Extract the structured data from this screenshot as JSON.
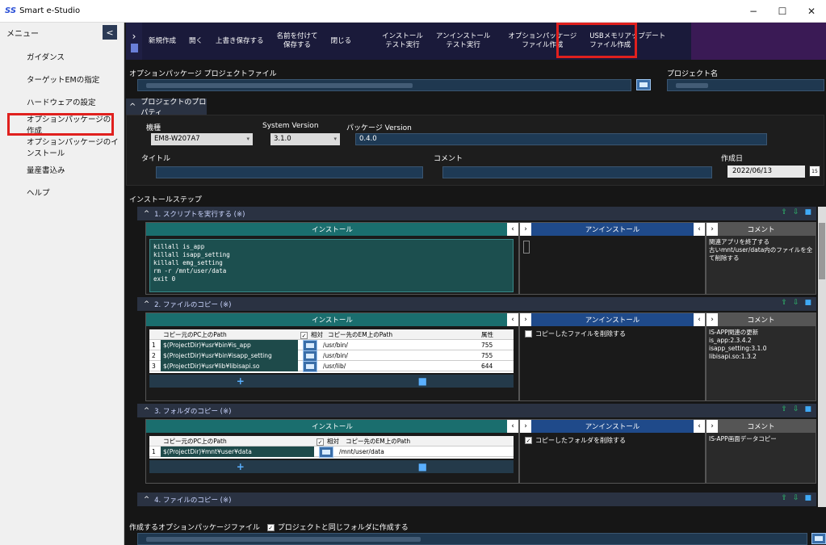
{
  "window": {
    "logo": "SS",
    "title": "Smart e-Studio",
    "minimize": "−",
    "maximize": "☐",
    "close": "✕"
  },
  "sidebar": {
    "header": "メニュー",
    "collapse_icon": "<",
    "items": [
      {
        "label": "ガイダンス"
      },
      {
        "label": "ターゲットEMの指定"
      },
      {
        "label": "ハードウェアの設定"
      },
      {
        "label": "オプションパッケージの作成"
      },
      {
        "label": "オプションパッケージのインストール"
      },
      {
        "label": "量産書込み"
      },
      {
        "label": "ヘルプ"
      }
    ]
  },
  "toolbar": {
    "buttons": [
      {
        "label": "新規作成"
      },
      {
        "label": "開く"
      },
      {
        "label": "上書き保存する"
      },
      {
        "label": "名前を付けて\n保存する"
      },
      {
        "label": "閉じる"
      },
      {
        "label": "インストール\nテスト実行"
      },
      {
        "label": "アンインストール\nテスト実行"
      },
      {
        "label": "オプションパッケージ\nファイル作成"
      },
      {
        "label": "USBメモリアップデート\nファイル作成"
      }
    ]
  },
  "project": {
    "file_label": "オプションパッケージ プロジェクトファイル",
    "name_label": "プロジェクト名",
    "props_header": "プロジェクトのプロパティ",
    "model_label": "機種",
    "model_value": "EM8-W207A7",
    "sysver_label": "System Version",
    "sysver_value": "3.1.0",
    "pkgver_label": "パッケージ Version",
    "pkgver_value": "0.4.0",
    "title_label": "タイトル",
    "comment_label": "コメント",
    "date_label": "作成日",
    "date_value": "2022/06/13",
    "cal_icon": "15"
  },
  "steps_label": "インストールステップ",
  "panel_labels": {
    "install": "インストール",
    "uninstall": "アンインストール",
    "comment": "コメント"
  },
  "steps": [
    {
      "title": "1.  スクリプトを実行する (※)",
      "install_lines": [
        "killall is_app",
        "killall isapp_setting",
        "killall emg_setting",
        "rm -r /mnt/user/data",
        "exit 0"
      ],
      "comment": "関連アプリを終了する\n古いmnt/user/data内のファイルを全て削除する"
    },
    {
      "title": "2.  ファイルのコピー (※)",
      "col_src": "コピー元のPC上のPath",
      "col_rel": "相対",
      "col_dst": "コピー先のEM上のPath",
      "col_attr": "属性",
      "rows": [
        {
          "n": "1",
          "src": "$(ProjectDir)¥usr¥bin¥is_app",
          "dst": "/usr/bin/",
          "attr": "755"
        },
        {
          "n": "2",
          "src": "$(ProjectDir)¥usr¥bin¥isapp_setting",
          "dst": "/usr/bin/",
          "attr": "755"
        },
        {
          "n": "3",
          "src": "$(ProjectDir)¥usr¥lib¥libisapi.so",
          "dst": "/usr/lib/",
          "attr": "644"
        }
      ],
      "uninstall_check": "コピーしたファイルを削除する",
      "comment": "IS-APP関連の更新\nis_app:2.3.4.2\nisapp_setting:3.1.0\nlibisapi.so:1.3.2"
    },
    {
      "title": "3.  フォルダのコピー (※)",
      "col_src": "コピー元のPC上のPath",
      "col_rel": "相対",
      "col_dst": "コピー先のEM上のPath",
      "rows": [
        {
          "n": "1",
          "src": "$(ProjectDir)¥mnt¥user¥data",
          "dst": "/mnt/user/data"
        }
      ],
      "uninstall_check": "コピーしたフォルダを削除する",
      "comment": "IS-APP画面データコピー"
    },
    {
      "title": "4.  ファイルのコピー (※)"
    }
  ],
  "bottom": {
    "label": "作成するオプションパッケージファイル",
    "check": "プロジェクトと同じフォルダに作成する"
  },
  "colors": {
    "highlight": "#e0201e",
    "toolbar": "#1a1a3a",
    "install": "#1a6e6e",
    "uninstall": "#1f4a8a"
  }
}
